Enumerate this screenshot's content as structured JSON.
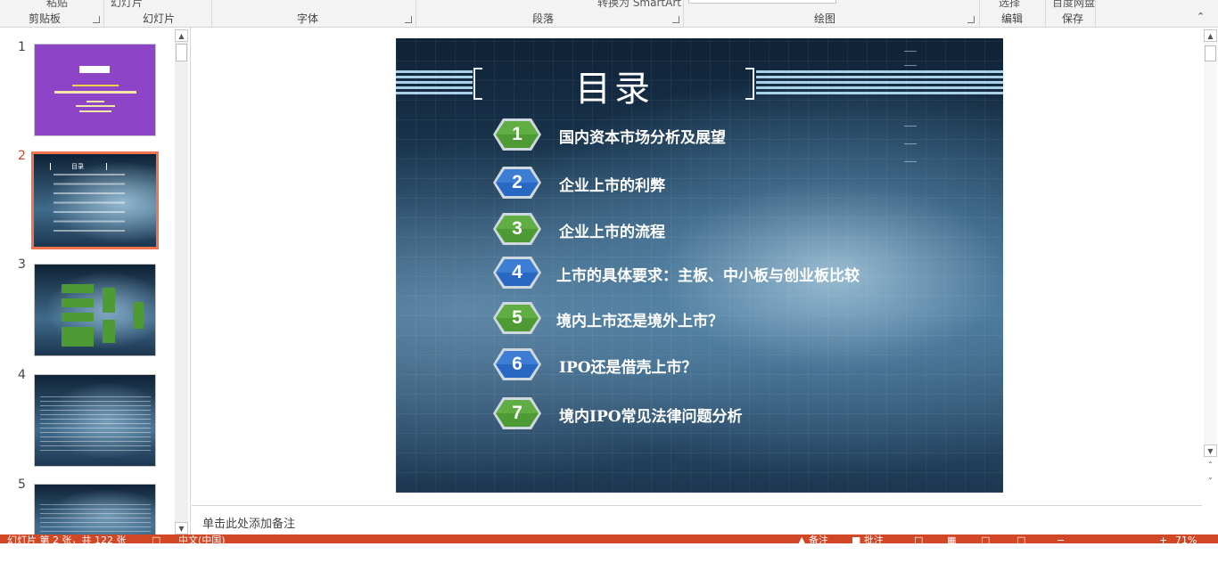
{
  "ribbon": {
    "top_fragments": {
      "paste_fragment": "粘贴",
      "slide_fragment": "幻灯片",
      "shape_fragment": "转换为 SmartArt",
      "select_fragment": "选择",
      "save_fragment": "百度网盘"
    },
    "groups": {
      "clipboard": "剪贴板",
      "slides": "幻灯片",
      "font": "字体",
      "paragraph": "段落",
      "drawing": "绘图",
      "editing": "编辑",
      "save": "保存"
    }
  },
  "thumbnails": [
    {
      "number": "1",
      "active": false
    },
    {
      "number": "2",
      "active": true
    },
    {
      "number": "3",
      "active": false
    },
    {
      "number": "4",
      "active": false
    },
    {
      "number": "5",
      "active": false
    }
  ],
  "slide": {
    "title": "目录",
    "items": [
      {
        "num": "1",
        "text": "国内资本市场分析及展望",
        "color": "green"
      },
      {
        "num": "2",
        "text": "企业上市的利弊",
        "color": "blue"
      },
      {
        "num": "3",
        "text": "企业上市的流程",
        "color": "green"
      },
      {
        "num": "4",
        "text": "上市的具体要求：主板、中小板与创业板比较",
        "color": "blue"
      },
      {
        "num": "5",
        "text": "境内上市还是境外上市？",
        "color": "green"
      },
      {
        "num": "6",
        "text": "IPO还是借壳上市？",
        "color": "blue"
      },
      {
        "num": "7",
        "text": "境内IPO常见法律问题分析",
        "color": "green"
      }
    ]
  },
  "notes": {
    "placeholder": "单击此处添加备注"
  },
  "statusbar": {
    "slide_info": "幻灯片 第 2 张，共 122 张",
    "language": "中文(中国)",
    "notes_label": "备注",
    "comments_label": "批注",
    "zoom": "71%"
  },
  "colors": {
    "accent": "#d24726",
    "hex_green": "#4e9a35",
    "hex_blue": "#2867c2"
  }
}
